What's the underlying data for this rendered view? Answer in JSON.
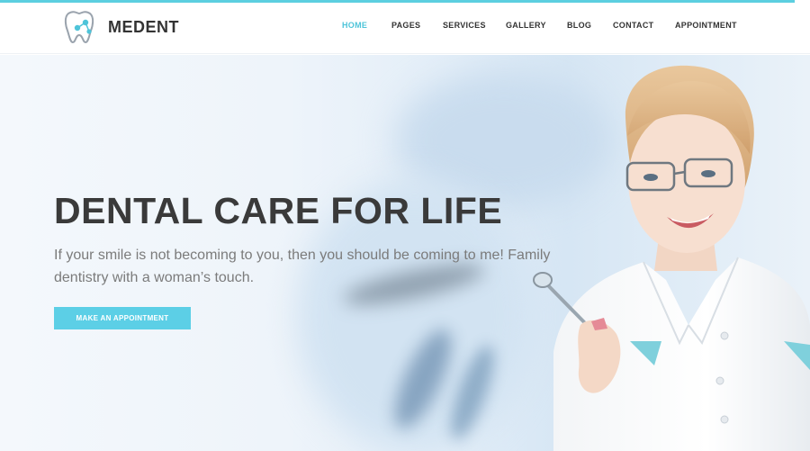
{
  "header": {
    "logo_icon": "tooth-icon",
    "brand": "MEDENT",
    "accent_color": "#5ccfe0"
  },
  "nav": {
    "items": [
      {
        "label": "HOME",
        "active": true
      },
      {
        "label": "PAGES",
        "active": false
      },
      {
        "label": "SERVICES",
        "active": false
      },
      {
        "label": "GALLERY",
        "active": false
      },
      {
        "label": "BLOG",
        "active": false
      },
      {
        "label": "CONTACT",
        "active": false
      },
      {
        "label": "APPOINTMENT",
        "active": false
      }
    ]
  },
  "hero": {
    "title": "DENTAL CARE FOR LIFE",
    "subtitle": "If your smile is not becoming to you, then you should be coming to me! Family dentistry with a woman’s touch.",
    "cta_label": "MAKE AN APPOINTMENT",
    "cta_color": "#5ccfe6",
    "image": "dentist-woman-holding-mirror"
  }
}
